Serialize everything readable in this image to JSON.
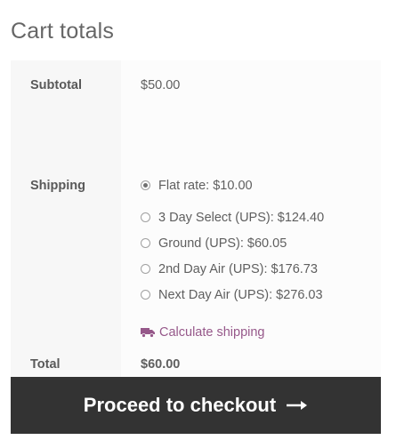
{
  "cart_totals": {
    "title": "Cart totals",
    "subtotal": {
      "label": "Subtotal",
      "value": "$50.00"
    },
    "shipping": {
      "label": "Shipping",
      "options": [
        {
          "label": "Flat rate: $10.00",
          "selected": true
        },
        {
          "label": "3 Day Select (UPS): $124.40",
          "selected": false
        },
        {
          "label": "Ground (UPS): $60.05",
          "selected": false
        },
        {
          "label": "2nd Day Air (UPS): $176.73",
          "selected": false
        },
        {
          "label": "Next Day Air (UPS): $276.03",
          "selected": false
        }
      ],
      "calculate_link": "Calculate shipping",
      "calculate_icon": "truck-icon"
    },
    "total": {
      "label": "Total",
      "value": "$60.00"
    }
  },
  "checkout": {
    "button_label": "Proceed to checkout",
    "button_icon": "arrow-right-icon"
  },
  "colors": {
    "link": "#96588a",
    "button_bg": "#333333",
    "button_text": "#ffffff"
  }
}
